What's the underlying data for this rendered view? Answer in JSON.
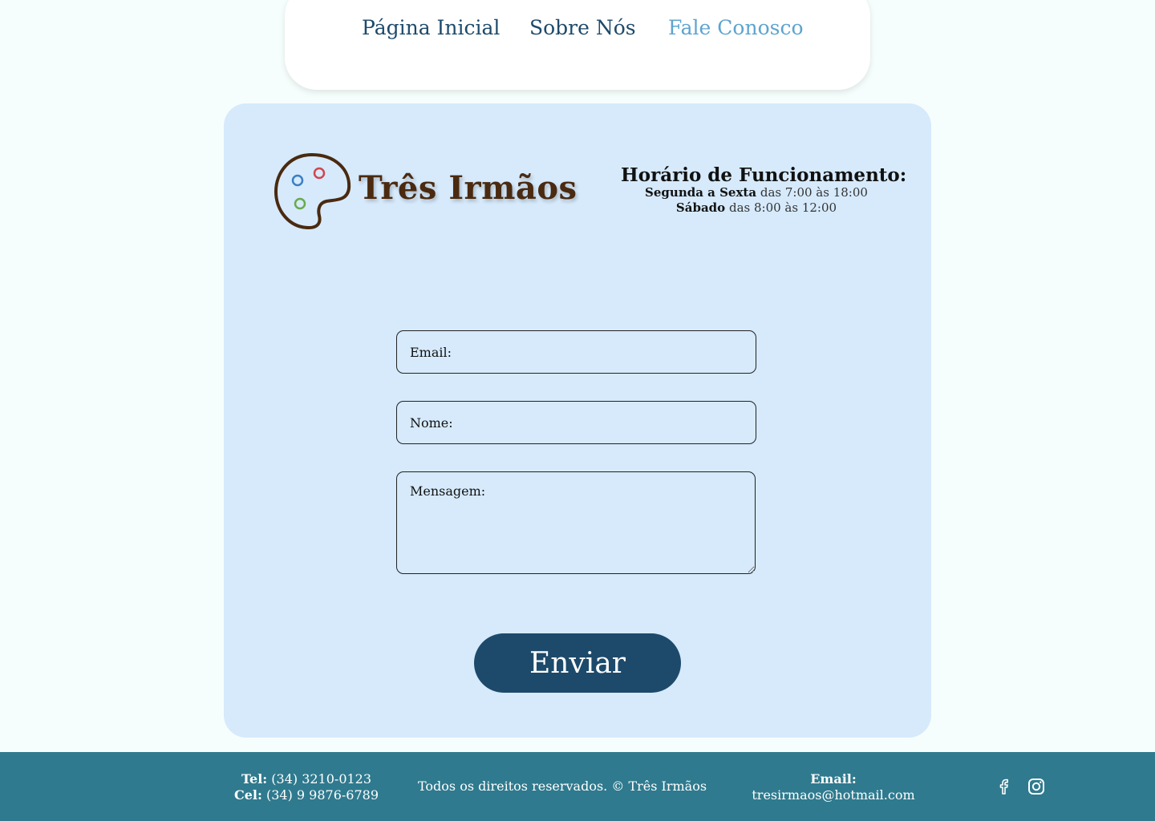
{
  "nav": {
    "items": [
      {
        "label": "Página Inicial"
      },
      {
        "label": "Sobre Nós"
      },
      {
        "label": "Fale Conosco"
      }
    ]
  },
  "brand": {
    "name": "Três Irmãos",
    "palette_color": "#4a2a10",
    "dot_colors": [
      "#3b7fc4",
      "#d0464e",
      "#6aaa4a"
    ]
  },
  "hours": {
    "title": "Horário de Funcionamento:",
    "weekday_label": "Segunda a Sexta",
    "weekday_time": "das 7:00 às 18:00",
    "saturday_label": "Sábado",
    "saturday_time": "das 8:00 às 12:00"
  },
  "form": {
    "email_placeholder": "Email:",
    "name_placeholder": "Nome:",
    "message_placeholder": "Mensagem:",
    "submit_label": "Enviar"
  },
  "footer": {
    "tel_label": "Tel:",
    "tel": "(34) 3210-0123",
    "cel_label": "Cel:",
    "cel": "(34) 9 9876-6789",
    "copyright": "Todos os direitos reservados. © Três Irmãos",
    "email_label": "Email:",
    "email": "tresirmaos@hotmail.com",
    "social": [
      "facebook-icon",
      "instagram-icon"
    ]
  },
  "colors": {
    "page_bg": "#f6fefd",
    "card_bg": "#d6eafc",
    "nav_text": "#1d4a6b",
    "nav_active": "#5ea4cf",
    "button_bg": "#1d4a6b",
    "footer_bg": "#2f7a8e"
  }
}
